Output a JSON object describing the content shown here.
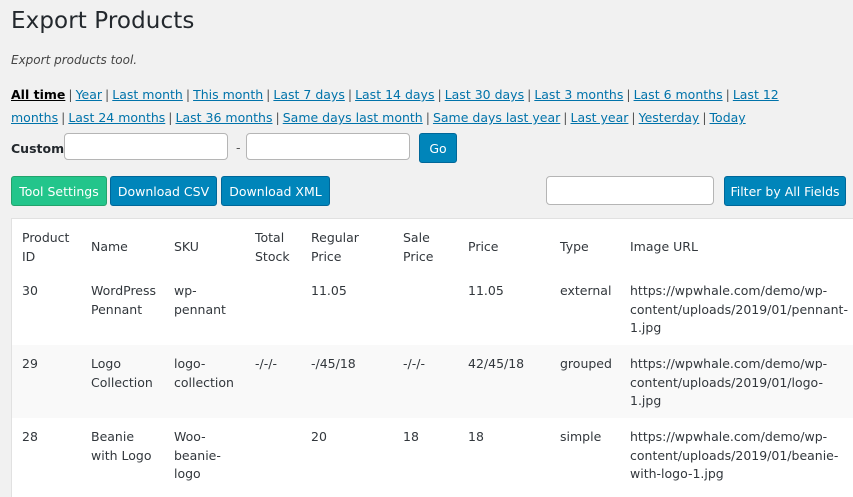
{
  "page": {
    "title": "Export Products",
    "subtitle": "Export products tool."
  },
  "ranges": [
    {
      "label": "All time",
      "active": true
    },
    {
      "label": "Year"
    },
    {
      "label": "Last month"
    },
    {
      "label": "This month"
    },
    {
      "label": "Last 7 days"
    },
    {
      "label": "Last 14 days"
    },
    {
      "label": "Last 30 days"
    },
    {
      "label": "Last 3 months"
    },
    {
      "label": "Last 6 months"
    },
    {
      "label": "Last 12 months"
    },
    {
      "label": "Last 24 months"
    },
    {
      "label": "Last 36 months"
    },
    {
      "label": "Same days last month"
    },
    {
      "label": "Same days last year"
    },
    {
      "label": "Last year"
    },
    {
      "label": "Yesterday"
    },
    {
      "label": "Today"
    }
  ],
  "custom": {
    "label": "Custom:",
    "from_value": "",
    "to_value": "",
    "separator": "-",
    "go_label": "Go"
  },
  "toolbar": {
    "tool_settings": "Tool Settings",
    "download_csv": "Download CSV",
    "download_xml": "Download XML",
    "filter_value": "",
    "filter_label": "Filter by All Fields"
  },
  "colors": {
    "primary": "#0085ba",
    "green": "#23c58b",
    "link": "#0073aa"
  },
  "table": {
    "headers": {
      "id": [
        "Product",
        "ID"
      ],
      "name": [
        "Name"
      ],
      "sku": [
        "SKU"
      ],
      "stock": [
        "Total",
        "Stock"
      ],
      "regular": [
        "Regular",
        "Price"
      ],
      "sale": [
        "Sale",
        "Price"
      ],
      "price": [
        "Price"
      ],
      "type": [
        "Type"
      ],
      "image": [
        "Image URL"
      ]
    },
    "rows": [
      {
        "id": [
          "30"
        ],
        "name": [
          "WordPress",
          "Pennant"
        ],
        "sku": [
          "wp-",
          "pennant"
        ],
        "stock": [],
        "regular": [
          "11.05"
        ],
        "sale": [],
        "price": [
          "11.05"
        ],
        "type": [
          "external"
        ],
        "image": [
          "https://wpwhale.com/demo/wp-",
          "content/uploads/2019/01/pennant-",
          "1.jpg"
        ]
      },
      {
        "id": [
          "29"
        ],
        "name": [
          "Logo",
          "Collection"
        ],
        "sku": [
          "logo-",
          "collection"
        ],
        "stock": [
          "-/-/-"
        ],
        "regular": [
          "-/45/18"
        ],
        "sale": [
          "-/-/-"
        ],
        "price": [
          "42/45/18"
        ],
        "type": [
          "grouped"
        ],
        "image": [
          "https://wpwhale.com/demo/wp-",
          "content/uploads/2019/01/logo-1.jpg"
        ]
      },
      {
        "id": [
          "28"
        ],
        "name": [
          "Beanie",
          "with Logo"
        ],
        "sku": [
          "Woo-",
          "beanie-",
          "logo"
        ],
        "stock": [],
        "regular": [
          "20"
        ],
        "sale": [
          "18"
        ],
        "price": [
          "18"
        ],
        "type": [
          "simple"
        ],
        "image": [
          "https://wpwhale.com/demo/wp-",
          "content/uploads/2019/01/beanie-",
          "with-logo-1.jpg"
        ]
      }
    ]
  }
}
